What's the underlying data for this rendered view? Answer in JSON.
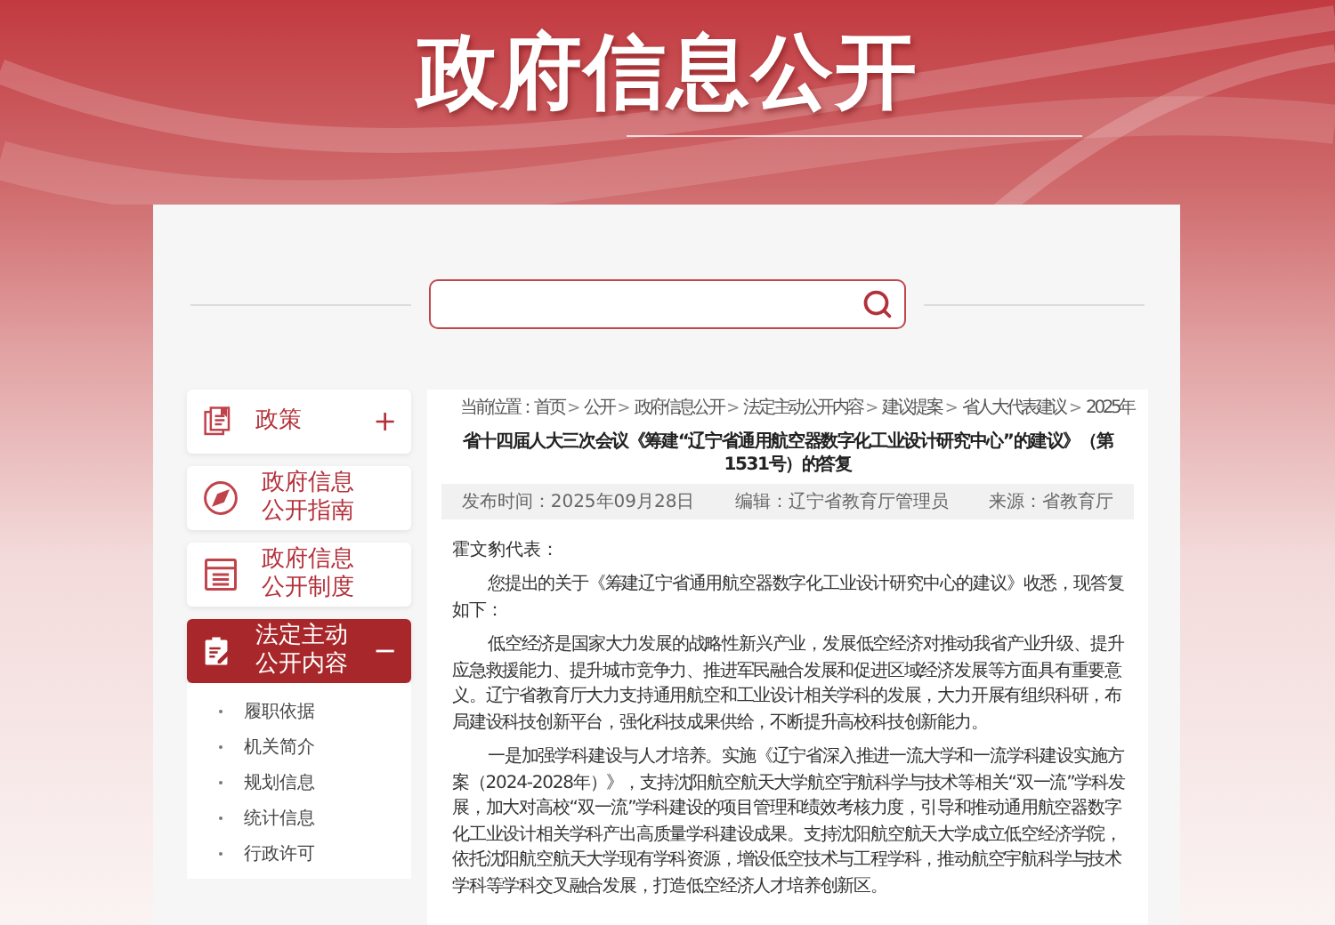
{
  "header": {
    "title": "政府信息公开"
  },
  "sidebar": {
    "items": [
      {
        "kind": "policy",
        "label": "政策",
        "toggle": "+",
        "selected": false
      },
      {
        "kind": "guide",
        "label": "政府信息公开指南",
        "selected": false
      },
      {
        "kind": "system",
        "label": "政府信息公开制度",
        "selected": false
      },
      {
        "kind": "content",
        "label": "法定主动公开内容",
        "toggle": "−",
        "selected": true,
        "children": [
          {
            "label": "履职依据"
          },
          {
            "label": "机关简介"
          },
          {
            "label": "规划信息"
          },
          {
            "label": "统计信息"
          },
          {
            "label": "行政许可"
          }
        ]
      }
    ]
  },
  "article": {
    "breadcrumb": {
      "prefix": "当前位置：",
      "separator": ">",
      "items": [
        "首页",
        "公开",
        "政府信息公开",
        "法定主动公开内容",
        "建议提案",
        "省人大代表建议",
        "2025年"
      ]
    },
    "title": "省十四届人大三次会议《筹建“辽宁省通用航空器数字化工业设计研究中心”的建议》（第1531号）的答复",
    "meta": [
      "发布时间：2025年09月28日",
      "编辑：辽宁省教育厅管理员",
      "来源：省教育厅"
    ],
    "salutation": "霍文豹代表：",
    "paragraphs": [
      "您提出的关于《筹建辽宁省通用航空器数字化工业设计研究中心的建议》收悉，现答复如下：",
      "低空经济是国家大力发展的战略性新兴产业，发展低空经济对推动我省产业升级、提升应急救援能力、提升城市竞争力、推进军民融合发展和促进区域经济发展等方面具有重要意义。辽宁省教育厅大力支持通用航空和工业设计相关学科的发展，大力开展有组织科研，布局建设科技创新平台，强化科技成果供给，不断提升高校科技创新能力。",
      "一是加强学科建设与人才培养。实施《辽宁省深入推进一流大学和一流学科建设实施方案（2024-2028年）》，支持沈阳航空航天大学航空宇航科学与技术等相关“双一流”学科发展，加大对高校“双一流”学科建设的项目管理和绩效考核力度，引导和推动通用航空器数字化工业设计相关学科产出高质量学科建设成果。支持沈阳航空航天大学成立低空经济学院，依托沈阳航空航天大学现有学科资源，增设低空技术与工程学科，推动航空宇航科学与技术学科等学科交叉融合发展，打造低空经济人才培养创新区。"
    ]
  }
}
